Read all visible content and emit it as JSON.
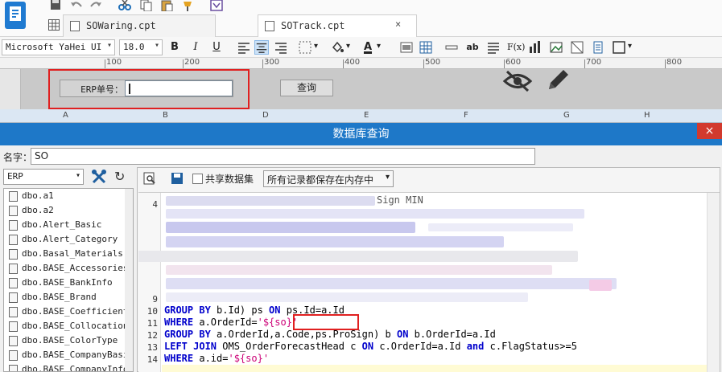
{
  "tabs": [
    {
      "label": "SOWaring.cpt"
    },
    {
      "label": "SOTrack.cpt"
    }
  ],
  "format_toolbar": {
    "font_name": "Microsoft YaHei UI",
    "font_size": "18.0",
    "bold": "B",
    "italic": "I",
    "underline": "U",
    "text_tool": "ab"
  },
  "ruler": {
    "ticks": [
      "100",
      "200",
      "300",
      "400",
      "500",
      "600",
      "700",
      "800"
    ]
  },
  "design": {
    "erp_label": "ERP单号：",
    "query_button": "查询"
  },
  "columns": [
    "A",
    "B",
    "D",
    "E",
    "F",
    "G",
    "H"
  ],
  "dialog": {
    "title": "数据库查询",
    "close": "×",
    "name_label": "名字：",
    "name_value": "SO",
    "datasource": "ERP",
    "share_label": "共享数据集",
    "memory_option": "所有记录都保存在内存中",
    "tables": [
      "dbo.a1",
      "dbo.a2",
      "dbo.Alert_Basic",
      "dbo.Alert_Category",
      "dbo.Basal_Materials",
      "dbo.BASE_Accessories",
      "dbo.BASE_BankInfo",
      "dbo.BASE_Brand",
      "dbo.BASE_Coefficient",
      "dbo.BASE_CollocationType",
      "dbo.BASE_ColorType",
      "dbo.BASE_CompanyBasic",
      "dbo.BASE_CompanyInfo"
    ],
    "line_numbers": [
      "4",
      "9",
      "10",
      "11",
      "12",
      "13",
      "14"
    ],
    "code_partial": "Sign MIN",
    "code": {
      "l10": {
        "k1": "GROUP BY",
        "t1": " b.Id) ps ",
        "k2": "ON",
        "t2": " ps.Id=a.Id"
      },
      "l11": {
        "k1": "WHERE",
        "t1": " a.OrderId=",
        "s1": "'${so}'"
      },
      "l12": {
        "k1": "GROUP BY",
        "t1": " a.OrderId,a.Code,ps.ProSign) b ",
        "k2": "ON",
        "t2": " b.OrderId=a.Id"
      },
      "l13": {
        "k1": "LEFT JOIN",
        "t1": " OMS_OrderForecastHead c ",
        "k2": "ON",
        "t2": " c.OrderId=a.Id ",
        "k3": "and",
        "t3": " c.FlagStatus>=5"
      },
      "l14": {
        "k1": "WHERE",
        "t1": " a.id=",
        "s1": "'${so}'"
      }
    }
  }
}
